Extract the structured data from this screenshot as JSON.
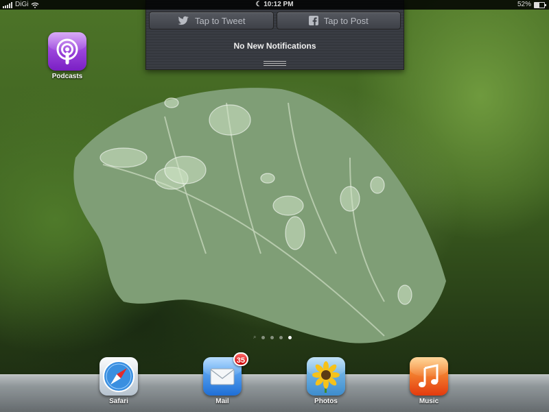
{
  "status_bar": {
    "carrier": "DiGi",
    "time": "10:12 PM",
    "battery": "52%",
    "battery_level": 0.52
  },
  "notification_center": {
    "tweet_label": "Tap to Tweet",
    "post_label": "Tap to Post",
    "message": "No New Notifications"
  },
  "home": {
    "apps": [
      {
        "label": "Podcasts",
        "icon": "podcasts-icon"
      }
    ],
    "page_count": 4,
    "current_page": 4
  },
  "dock": {
    "apps": [
      {
        "label": "Safari",
        "icon": "safari-icon"
      },
      {
        "label": "Mail",
        "icon": "mail-icon",
        "badge": "35"
      },
      {
        "label": "Photos",
        "icon": "photos-icon"
      },
      {
        "label": "Music",
        "icon": "music-icon"
      }
    ]
  },
  "colors": {
    "podcasts": "#8a2be2",
    "badge": "#d60000",
    "notification_bg": "#3a3d44"
  }
}
